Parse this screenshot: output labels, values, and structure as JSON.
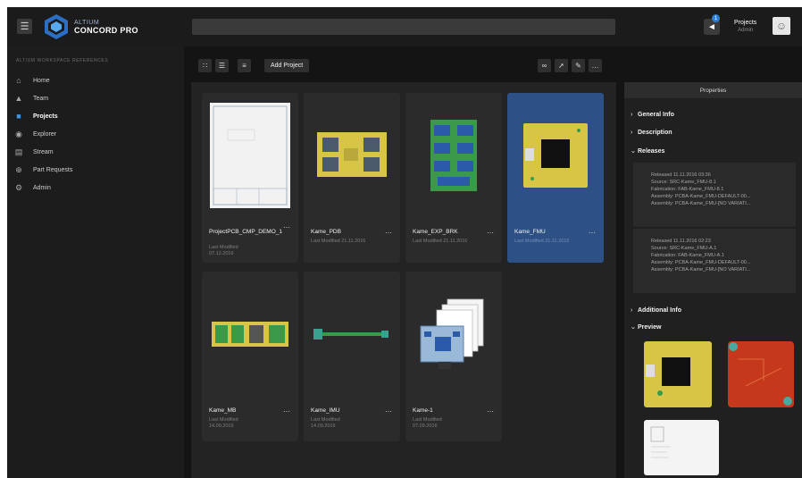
{
  "header": {
    "logo_line1": "ALTIUM",
    "logo_line2": "CONCORD PRO",
    "notification_count": "1",
    "user_name": "Projects",
    "user_sub": "Admin"
  },
  "sidebar": {
    "workspace_label": "ALTIUM WORKSPACE REFERENCES",
    "items": [
      {
        "label": "Home",
        "icon": "home-icon"
      },
      {
        "label": "Team",
        "icon": "team-icon"
      },
      {
        "label": "Projects",
        "icon": "folder-icon",
        "active": true
      },
      {
        "label": "Explorer",
        "icon": "explorer-icon"
      },
      {
        "label": "Stream",
        "icon": "stream-icon"
      },
      {
        "label": "Part Requests",
        "icon": "part-requests-icon"
      },
      {
        "label": "Admin",
        "icon": "admin-icon"
      }
    ]
  },
  "toolbar": {
    "add_project_label": "Add Project"
  },
  "projects": [
    {
      "name": "ProjectPCB_CMP_DEMO_1",
      "meta": "Last Modified",
      "date": "07.12.2016"
    },
    {
      "name": "Kame_PDB",
      "meta": "Last Modified 21.11.2016",
      "date": ""
    },
    {
      "name": "Kame_EXP_BRK",
      "meta": "Last Modified 21.11.2016",
      "date": ""
    },
    {
      "name": "Kame_FMU",
      "meta": "Last Modified 21.11.2016",
      "date": ""
    },
    {
      "name": "Kame_MB",
      "meta": "Last Modified",
      "date": "14.09.2016"
    },
    {
      "name": "Kame_IMU",
      "meta": "Last Modified",
      "date": "14.09.2016"
    },
    {
      "name": "Kame-1",
      "meta": "Last Modified",
      "date": "07.09.2016"
    }
  ],
  "properties": {
    "title": "Properties",
    "general_info": "General Info",
    "description": "Description",
    "releases": "Releases",
    "release_items": [
      {
        "released": "Released 11.11.2016 03:36",
        "source": "Source: SRC-Kame_FMU-8.1",
        "fabrication": "Fabrication: FAB-Kame_FMU-8.1",
        "assembly1": "Assembly: PCBA-Kame_FMU-DEFAULT-00...",
        "assembly2": "Assembly: PCBA-Kame_FMU-[NO VARIATI..."
      },
      {
        "released": "Released 11.11.2016 02:23",
        "source": "Source: SRC-Kame_FMU-A.1",
        "fabrication": "Fabrication: FAB-Kame_FMU-A.1",
        "assembly1": "Assembly: PCBA-Kame_FMU-DEFAULT-00...",
        "assembly2": "Assembly: PCBA-Kame_FMU-[NO VARIATI..."
      }
    ],
    "additional_info": "Additional Info",
    "preview": "Preview"
  },
  "colors": {
    "accent": "#2d5184",
    "pcb_yellow": "#d8c545",
    "pcb_red": "#c6381c",
    "pcb_blue": "#2a5aa8",
    "pcb_green": "#3a9a4a"
  }
}
